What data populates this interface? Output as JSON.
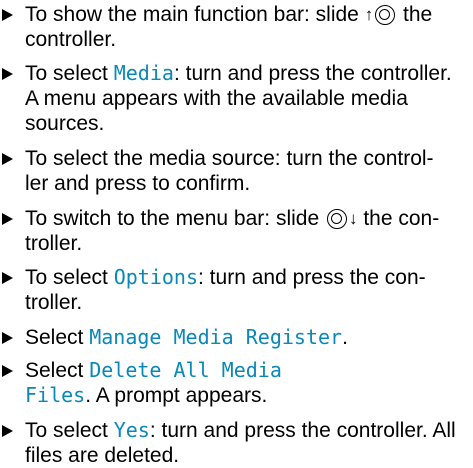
{
  "steps": [
    {
      "a": "To show the main function bar: slide ",
      "arrow": "↑",
      "b": " the controller."
    },
    {
      "a": "To select ",
      "ui": "Media",
      "b": ": turn and press the controller. A menu appears with the available media sources."
    },
    {
      "a": "To select the media source: turn the control-ler and press to confirm."
    },
    {
      "a": "To switch to the menu bar: slide ",
      "arrow": "↓",
      "b": " the con-troller."
    },
    {
      "a": "To select ",
      "ui": "Options",
      "b": ": turn and press the con-troller."
    },
    {
      "a": "Select ",
      "ui": "Manage Media Register",
      "b": "."
    },
    {
      "a": "Select ",
      "ui": "Delete All Media Files",
      "b": ". A prompt appears."
    },
    {
      "a": "To select ",
      "ui": "Yes",
      "b": ": turn and press the controller. All files are deleted."
    }
  ]
}
